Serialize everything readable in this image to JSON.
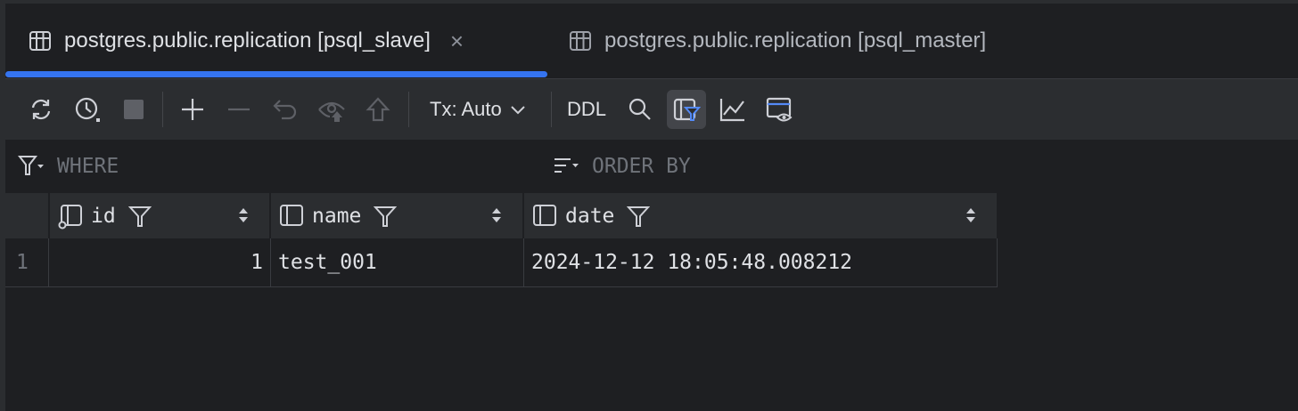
{
  "tabs": [
    {
      "label": "postgres.public.replication [psql_slave]",
      "active": true,
      "close_icon": "×"
    },
    {
      "label": "postgres.public.replication [psql_master]",
      "active": false
    }
  ],
  "toolbar": {
    "tx_label": "Tx: Auto",
    "ddl_label": "DDL"
  },
  "filter": {
    "where_label": "WHERE",
    "orderby_label": "ORDER BY"
  },
  "table": {
    "columns": [
      {
        "name": "id"
      },
      {
        "name": "name"
      },
      {
        "name": "date"
      }
    ],
    "rows": [
      {
        "num": "1",
        "cells": [
          "1",
          "test_001",
          "2024-12-12 18:05:48.008212"
        ]
      }
    ]
  },
  "colors": {
    "accent": "#3574f0",
    "background": "#1e1f22",
    "panel": "#2b2d30"
  }
}
